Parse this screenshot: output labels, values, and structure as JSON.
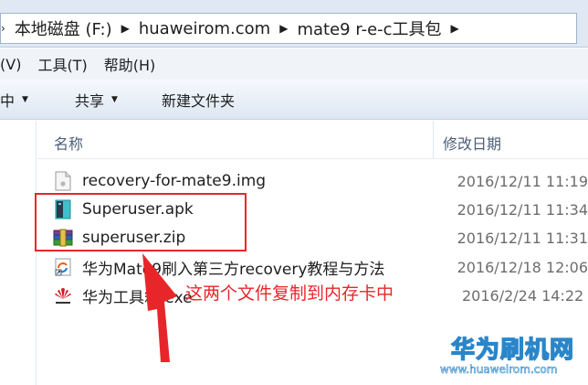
{
  "address_bar": {
    "crumbs": [
      "本地磁盘 (F:)",
      "huaweirom.com",
      "mate9 r-e-c工具包"
    ]
  },
  "menu": {
    "items": [
      "(V)",
      "工具(T)",
      "帮助(H)"
    ]
  },
  "toolbar": {
    "buttons": [
      "中",
      "共享",
      "新建文件夹"
    ]
  },
  "columns": {
    "name": "名称",
    "date": "修改日期"
  },
  "files": [
    {
      "name": "recovery-for-mate9.img",
      "date": "2016/12/11 11:19",
      "icon": "disk-image-icon"
    },
    {
      "name": "Superuser.apk",
      "date": "2016/12/11 11:34",
      "icon": "apk-icon"
    },
    {
      "name": "superuser.zip",
      "date": "2016/12/11 11:31",
      "icon": "winrar-archive-icon"
    },
    {
      "name": "华为Mate9刷入第三方recovery教程与方法",
      "date": "2016/12/18 12:06",
      "icon": "shortcut-icon"
    },
    {
      "name": "华为工具箱.exe",
      "date": "2016/2/24 14:22",
      "icon": "huawei-logo-icon"
    }
  ],
  "annotation": {
    "text": "这两个文件复制到内存卡中",
    "color": "#e8262a"
  },
  "watermark": {
    "title": "华为刷机网",
    "url": "www.huaweirom.com",
    "color": "#2a86c9"
  }
}
